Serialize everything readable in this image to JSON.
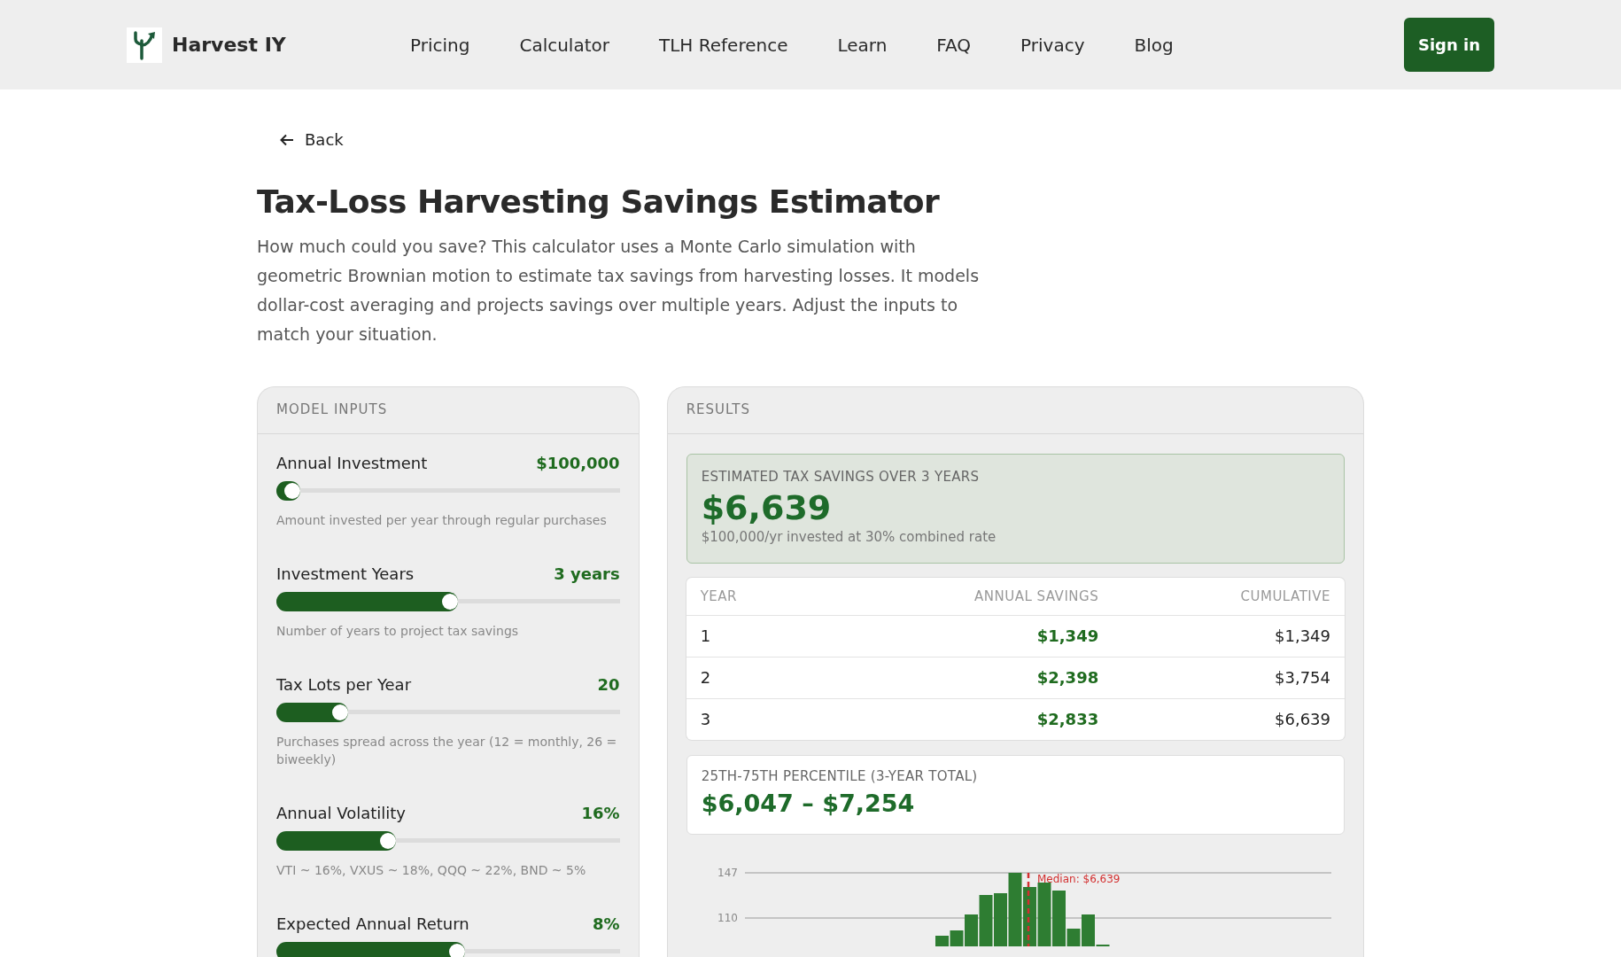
{
  "header": {
    "brand": "Harvest IY",
    "nav": [
      "Pricing",
      "Calculator",
      "TLH Reference",
      "Learn",
      "FAQ",
      "Privacy",
      "Blog"
    ],
    "sign_in": "Sign in"
  },
  "back": "Back",
  "title": "Tax-Loss Harvesting Savings Estimator",
  "intro": "How much could you save? This calculator uses a Monte Carlo simulation with geometric Brownian motion to estimate tax savings from harvesting losses. It models dollar-cost averaging and projects savings over multiple years. Adjust the inputs to match your situation.",
  "inputs": {
    "heading": "MODEL INPUTS",
    "sliders": [
      {
        "label": "Annual Investment",
        "value": "$100,000",
        "level": 0.04,
        "hint": "Amount invested per year through regular purchases"
      },
      {
        "label": "Investment Years",
        "value": "3 years",
        "level": 0.5,
        "hint": "Number of years to project tax savings"
      },
      {
        "label": "Tax Lots per Year",
        "value": "20",
        "level": 0.18,
        "hint": "Purchases spread across the year (12 = monthly, 26 = biweekly)"
      },
      {
        "label": "Annual Volatility",
        "value": "16%",
        "level": 0.32,
        "hint": "VTI ~ 16%, VXUS ~ 18%, QQQ ~ 22%, BND ~ 5%"
      },
      {
        "label": "Expected Annual Return",
        "value": "8%",
        "level": 0.52
      }
    ]
  },
  "results": {
    "heading": "RESULTS",
    "estimate": {
      "label": "ESTIMATED TAX SAVINGS OVER 3 YEARS",
      "amount": "$6,639",
      "note": "$100,000/yr invested at 30% combined rate"
    },
    "table": {
      "columns": [
        "YEAR",
        "ANNUAL SAVINGS",
        "CUMULATIVE"
      ],
      "rows": [
        [
          "1",
          "$1,349",
          "$1,349"
        ],
        [
          "2",
          "$2,398",
          "$3,754"
        ],
        [
          "3",
          "$2,833",
          "$6,639"
        ]
      ]
    },
    "percentile": {
      "label": "25TH-75TH PERCENTILE (3-YEAR TOTAL)",
      "range": "$6,047 – $7,254"
    },
    "histogram": {
      "tick_labels": [
        "147",
        "110"
      ],
      "median_label": "Median: $6,639"
    }
  }
}
